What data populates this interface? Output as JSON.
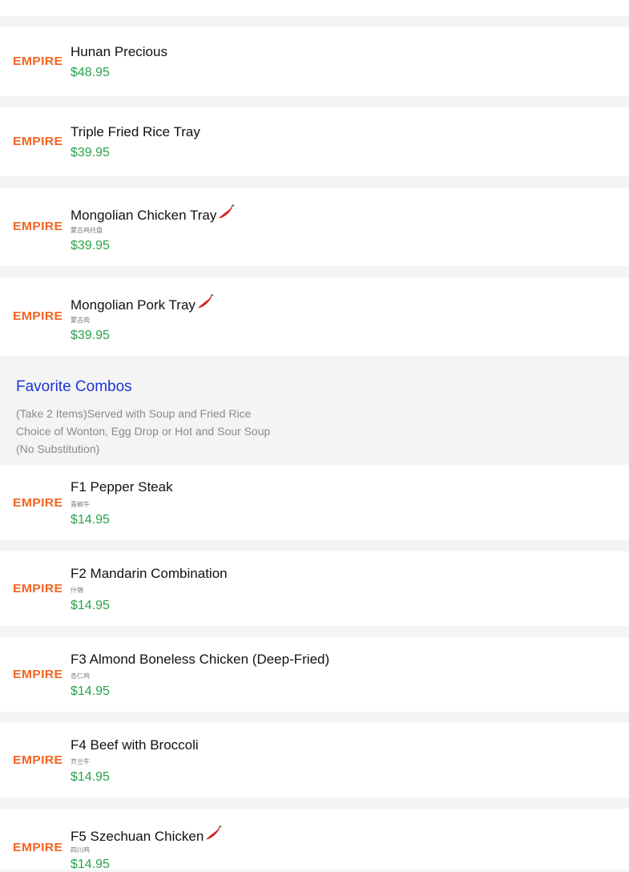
{
  "brand_logo_text": "EMPIRE",
  "colors": {
    "logo": "#f26522",
    "price": "#2aa34a",
    "section_title": "#1a35d6",
    "item_bg": "#ffffff",
    "page_bg": "#f4f4f4"
  },
  "items_top": [
    {
      "name": "Hunan Precious",
      "sub": "",
      "price": "$48.95",
      "spicy": false
    },
    {
      "name": "Triple Fried Rice Tray",
      "sub": "",
      "price": "$39.95",
      "spicy": false
    },
    {
      "name": "Mongolian Chicken Tray",
      "sub": "蒙古鸡托盘",
      "price": "$39.95",
      "spicy": true
    },
    {
      "name": "Mongolian Pork Tray",
      "sub": "蒙古肉",
      "price": "$39.95",
      "spicy": true
    }
  ],
  "favorite_combos": {
    "title": "Favorite Combos",
    "desc_line1": "(Take 2 Items)Served with Soup and Fried Rice",
    "desc_line2": "Choice of Wonton, Egg Drop or Hot and Sour Soup",
    "desc_line3": "(No Substitution)"
  },
  "combo_items": [
    {
      "name": "F1 Pepper Steak",
      "sub": "青椒牛",
      "price": "$14.95",
      "spicy": false
    },
    {
      "name": "F2 Mandarin Combination",
      "sub": "什锦",
      "price": "$14.95",
      "spicy": false
    },
    {
      "name": "F3 Almond Boneless Chicken (Deep-Fried)",
      "sub": "杏仁鸡",
      "price": "$14.95",
      "spicy": false
    },
    {
      "name": "F4 Beef with Broccoli",
      "sub": "芥兰牛",
      "price": "$14.95",
      "spicy": false
    },
    {
      "name": "F5 Szechuan Chicken",
      "sub": "四川鸡",
      "price": "$14.95",
      "spicy": true
    }
  ],
  "icons": {
    "spicy": "chili-pepper-icon"
  }
}
